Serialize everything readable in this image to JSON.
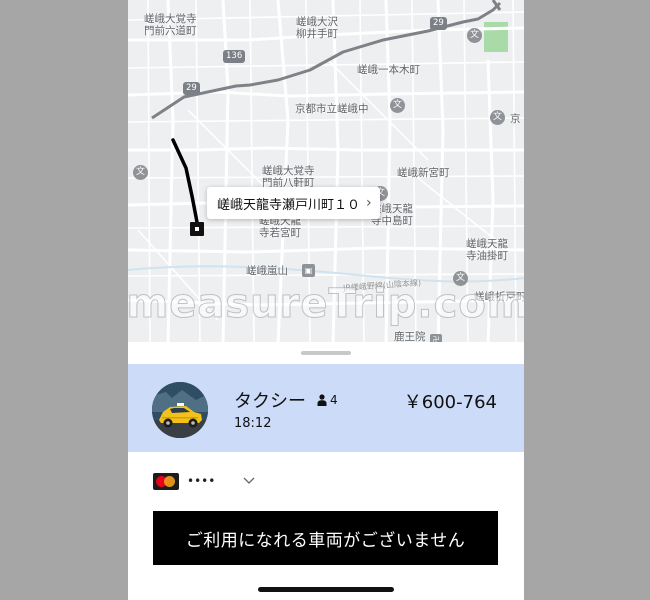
{
  "map": {
    "labels": {
      "saga_daikakuji_monzen_rokudocho": "嵯峨大覚寺\n門前六道町",
      "saga_osawa_yanagiidecho": "嵯峨大沢\n柳井手町",
      "saga_ipponkicho": "嵯峨一本木町",
      "kyoto_shiritsu_saga_chu": "京都市立嵯峨中",
      "saga_daikakuji_monzen_hachikencho": "嵯峨大覚寺\n門前八軒町",
      "saga_shinmiyacho": "嵯峨新宮町",
      "saga_tenryuji_nakajimacho": "嵯峨天龍\n寺中島町",
      "saga_tenryuji_wakamiyacho": "嵯峨天龍\n寺若宮町",
      "saga_tenryuji_aburakakecho": "嵯峨天龍\n寺油掛町",
      "saga_arashiyama": "嵯峨嵐山",
      "saga_orido": "嵯峨折戸町",
      "rokuoin": "鹿王院",
      "edge_kyo": "京",
      "rail_line": "JR嵯峨野線(山陰本線)"
    },
    "road_shields": {
      "route_136": "136",
      "route_29": "29",
      "route_29b": "29"
    },
    "poi_icon_name": "school-icon",
    "station_icon_name": "train-station-icon",
    "destination": "嵯峨天龍寺瀬戸川町１０",
    "destination_chevron": "›",
    "watermark": "measureTrip.com"
  },
  "ride": {
    "name": "タクシー",
    "capacity": "4",
    "time": "18:12",
    "price": "￥600-764",
    "selected": true,
    "vehicle_icon_name": "taxi-car-icon",
    "person_icon_name": "person-icon"
  },
  "payment": {
    "card_icon_name": "mastercard-icon",
    "card_mask": "••••",
    "chevron_icon_name": "chevron-down-icon"
  },
  "action": {
    "request_label": "ご利用になれる車両がございません"
  },
  "colors": {
    "selected_row": "#ccdbf7",
    "button_bg": "#000000",
    "route": "#000000",
    "map_bg": "#eeeff1",
    "background": "#a6a6a6"
  }
}
